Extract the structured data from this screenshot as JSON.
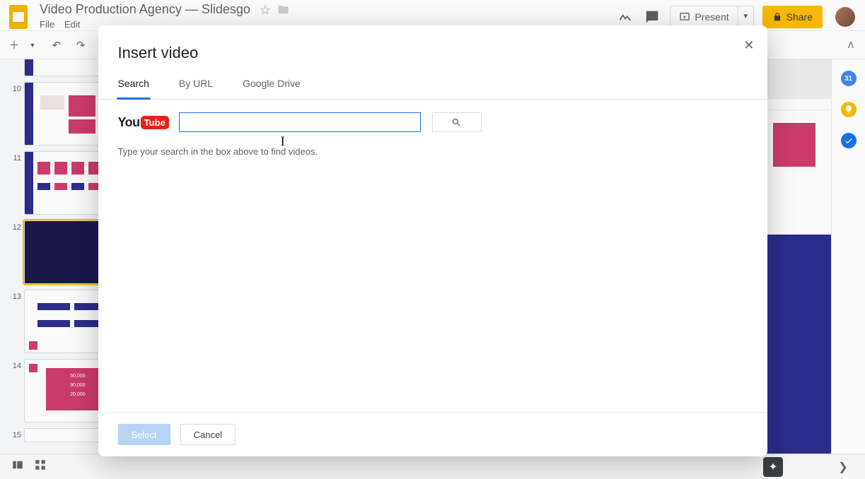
{
  "app": {
    "doc_title": "Video Production Agency — Slidesgo"
  },
  "menubar": {
    "file": "File",
    "edit": "Edit"
  },
  "title_actions": {
    "present": "Present",
    "share": "Share"
  },
  "filmstrip": {
    "slides": [
      {
        "num": "10"
      },
      {
        "num": "11"
      },
      {
        "num": "12"
      },
      {
        "num": "13"
      },
      {
        "num": "14"
      },
      {
        "num": "15"
      }
    ]
  },
  "thumb14_values": {
    "a": "50,000",
    "b": "90,000",
    "c": "20,000"
  },
  "modal": {
    "title": "Insert video",
    "tabs": {
      "search": "Search",
      "by_url": "By URL",
      "drive": "Google Drive"
    },
    "youtube": {
      "you": "You",
      "tube": "Tube"
    },
    "search_value": "",
    "hint": "Type your search in the box above to find videos.",
    "buttons": {
      "select": "Select",
      "cancel": "Cancel"
    }
  }
}
